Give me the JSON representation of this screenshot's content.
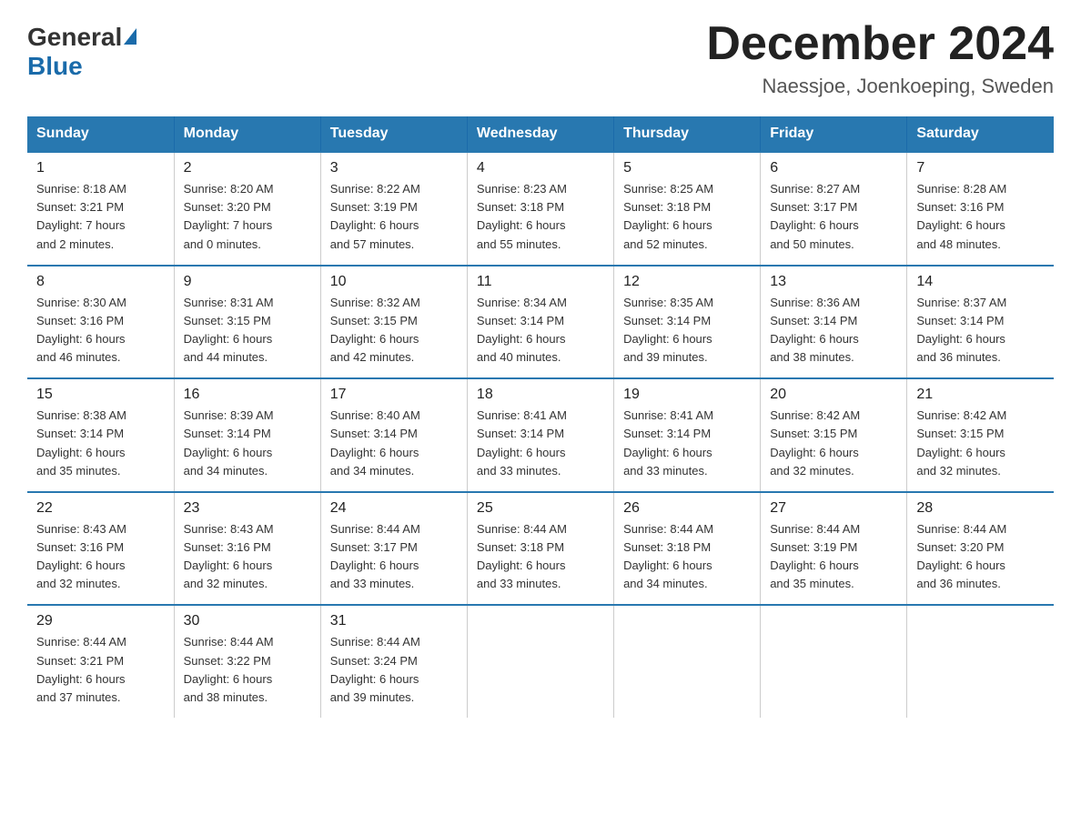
{
  "header": {
    "logo_general": "General",
    "logo_blue": "Blue",
    "month_title": "December 2024",
    "location": "Naessjoe, Joenkoeping, Sweden"
  },
  "days_of_week": [
    "Sunday",
    "Monday",
    "Tuesday",
    "Wednesday",
    "Thursday",
    "Friday",
    "Saturday"
  ],
  "weeks": [
    [
      {
        "day": "1",
        "sunrise": "8:18 AM",
        "sunset": "3:21 PM",
        "daylight_h": "7",
        "daylight_m": "2"
      },
      {
        "day": "2",
        "sunrise": "8:20 AM",
        "sunset": "3:20 PM",
        "daylight_h": "7",
        "daylight_m": "0"
      },
      {
        "day": "3",
        "sunrise": "8:22 AM",
        "sunset": "3:19 PM",
        "daylight_h": "6",
        "daylight_m": "57"
      },
      {
        "day": "4",
        "sunrise": "8:23 AM",
        "sunset": "3:18 PM",
        "daylight_h": "6",
        "daylight_m": "55"
      },
      {
        "day": "5",
        "sunrise": "8:25 AM",
        "sunset": "3:18 PM",
        "daylight_h": "6",
        "daylight_m": "52"
      },
      {
        "day": "6",
        "sunrise": "8:27 AM",
        "sunset": "3:17 PM",
        "daylight_h": "6",
        "daylight_m": "50"
      },
      {
        "day": "7",
        "sunrise": "8:28 AM",
        "sunset": "3:16 PM",
        "daylight_h": "6",
        "daylight_m": "48"
      }
    ],
    [
      {
        "day": "8",
        "sunrise": "8:30 AM",
        "sunset": "3:16 PM",
        "daylight_h": "6",
        "daylight_m": "46"
      },
      {
        "day": "9",
        "sunrise": "8:31 AM",
        "sunset": "3:15 PM",
        "daylight_h": "6",
        "daylight_m": "44"
      },
      {
        "day": "10",
        "sunrise": "8:32 AM",
        "sunset": "3:15 PM",
        "daylight_h": "6",
        "daylight_m": "42"
      },
      {
        "day": "11",
        "sunrise": "8:34 AM",
        "sunset": "3:14 PM",
        "daylight_h": "6",
        "daylight_m": "40"
      },
      {
        "day": "12",
        "sunrise": "8:35 AM",
        "sunset": "3:14 PM",
        "daylight_h": "6",
        "daylight_m": "39"
      },
      {
        "day": "13",
        "sunrise": "8:36 AM",
        "sunset": "3:14 PM",
        "daylight_h": "6",
        "daylight_m": "38"
      },
      {
        "day": "14",
        "sunrise": "8:37 AM",
        "sunset": "3:14 PM",
        "daylight_h": "6",
        "daylight_m": "36"
      }
    ],
    [
      {
        "day": "15",
        "sunrise": "8:38 AM",
        "sunset": "3:14 PM",
        "daylight_h": "6",
        "daylight_m": "35"
      },
      {
        "day": "16",
        "sunrise": "8:39 AM",
        "sunset": "3:14 PM",
        "daylight_h": "6",
        "daylight_m": "34"
      },
      {
        "day": "17",
        "sunrise": "8:40 AM",
        "sunset": "3:14 PM",
        "daylight_h": "6",
        "daylight_m": "34"
      },
      {
        "day": "18",
        "sunrise": "8:41 AM",
        "sunset": "3:14 PM",
        "daylight_h": "6",
        "daylight_m": "33"
      },
      {
        "day": "19",
        "sunrise": "8:41 AM",
        "sunset": "3:14 PM",
        "daylight_h": "6",
        "daylight_m": "33"
      },
      {
        "day": "20",
        "sunrise": "8:42 AM",
        "sunset": "3:15 PM",
        "daylight_h": "6",
        "daylight_m": "32"
      },
      {
        "day": "21",
        "sunrise": "8:42 AM",
        "sunset": "3:15 PM",
        "daylight_h": "6",
        "daylight_m": "32"
      }
    ],
    [
      {
        "day": "22",
        "sunrise": "8:43 AM",
        "sunset": "3:16 PM",
        "daylight_h": "6",
        "daylight_m": "32"
      },
      {
        "day": "23",
        "sunrise": "8:43 AM",
        "sunset": "3:16 PM",
        "daylight_h": "6",
        "daylight_m": "32"
      },
      {
        "day": "24",
        "sunrise": "8:44 AM",
        "sunset": "3:17 PM",
        "daylight_h": "6",
        "daylight_m": "33"
      },
      {
        "day": "25",
        "sunrise": "8:44 AM",
        "sunset": "3:18 PM",
        "daylight_h": "6",
        "daylight_m": "33"
      },
      {
        "day": "26",
        "sunrise": "8:44 AM",
        "sunset": "3:18 PM",
        "daylight_h": "6",
        "daylight_m": "34"
      },
      {
        "day": "27",
        "sunrise": "8:44 AM",
        "sunset": "3:19 PM",
        "daylight_h": "6",
        "daylight_m": "35"
      },
      {
        "day": "28",
        "sunrise": "8:44 AM",
        "sunset": "3:20 PM",
        "daylight_h": "6",
        "daylight_m": "36"
      }
    ],
    [
      {
        "day": "29",
        "sunrise": "8:44 AM",
        "sunset": "3:21 PM",
        "daylight_h": "6",
        "daylight_m": "37"
      },
      {
        "day": "30",
        "sunrise": "8:44 AM",
        "sunset": "3:22 PM",
        "daylight_h": "6",
        "daylight_m": "38"
      },
      {
        "day": "31",
        "sunrise": "8:44 AM",
        "sunset": "3:24 PM",
        "daylight_h": "6",
        "daylight_m": "39"
      },
      null,
      null,
      null,
      null
    ]
  ],
  "labels": {
    "sunrise": "Sunrise:",
    "sunset": "Sunset:",
    "daylight": "Daylight:",
    "hours": "hours",
    "and": "and",
    "minutes": "minutes."
  }
}
